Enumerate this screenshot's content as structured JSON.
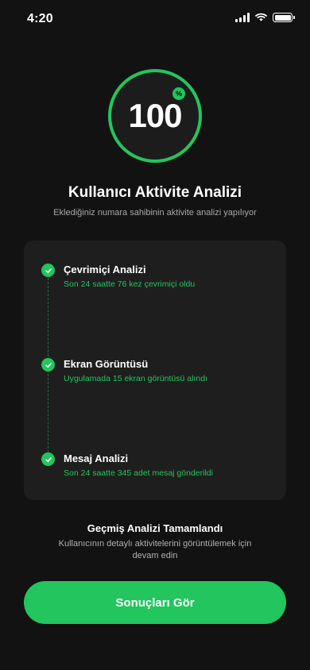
{
  "status_bar": {
    "time": "4:20",
    "icons": [
      "signal-icon",
      "wifi-icon",
      "battery-icon"
    ]
  },
  "progress": {
    "value_label": "100",
    "value": 100,
    "badge": "%"
  },
  "header": {
    "title": "Kullanıcı Aktivite Analizi",
    "subtitle": "Eklediğiniz numara sahibinin aktivite analizi yapılıyor"
  },
  "steps": [
    {
      "title": "Çevrimiçi Analizi",
      "description": "Son 24 saatte 76 kez çevrimiçi oldu",
      "icon": "check-icon"
    },
    {
      "title": "Ekran Görüntüsü",
      "description": "Uygulamada 15 ekran görüntüsü alındı",
      "icon": "check-icon"
    },
    {
      "title": "Mesaj Analizi",
      "description": "Son 24 saatte 345 adet mesaj gönderildi",
      "icon": "check-icon"
    }
  ],
  "completion": {
    "title": "Geçmiş Analizi Tamamlandı",
    "description": "Kullanıcının detaylı aktivitelerini görüntülemek için devam edin"
  },
  "cta": {
    "label": "Sonuçları Gör"
  },
  "colors": {
    "accent": "#22c55e",
    "background": "#121212",
    "card": "#1e1e1e"
  }
}
